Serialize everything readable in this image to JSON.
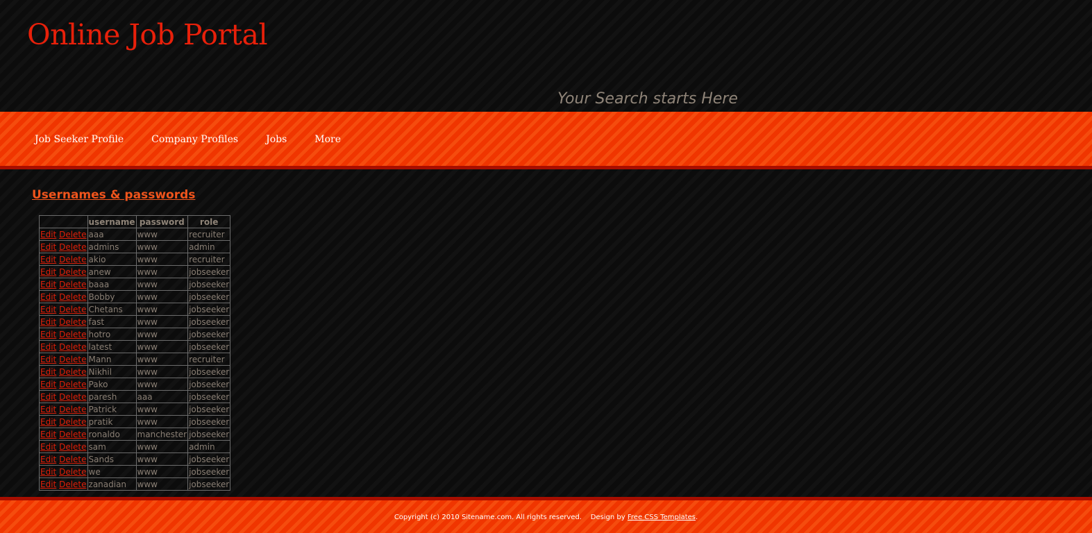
{
  "header": {
    "title": "Online Job Portal",
    "tagline": "Your Search starts Here"
  },
  "menu": {
    "items": [
      {
        "label": "Job Seeker Profile"
      },
      {
        "label": "Company Profiles"
      },
      {
        "label": "Jobs"
      },
      {
        "label": "More"
      }
    ]
  },
  "main": {
    "heading": "Usernames & passwords",
    "table": {
      "columns": [
        "",
        "username",
        "password",
        "role"
      ],
      "edit_label": "Edit",
      "delete_label": "Delete",
      "rows": [
        {
          "username": "aaa",
          "password": "www",
          "role": "recruiter"
        },
        {
          "username": "admins",
          "password": "www",
          "role": "admin"
        },
        {
          "username": "akio",
          "password": "www",
          "role": "recruiter"
        },
        {
          "username": "anew",
          "password": "www",
          "role": "jobseeker"
        },
        {
          "username": "baaa",
          "password": "www",
          "role": "jobseeker"
        },
        {
          "username": "Bobby",
          "password": "www",
          "role": "jobseeker"
        },
        {
          "username": "Chetans",
          "password": "www",
          "role": "jobseeker"
        },
        {
          "username": "fast",
          "password": "www",
          "role": "jobseeker"
        },
        {
          "username": "hotro",
          "password": "www",
          "role": "jobseeker"
        },
        {
          "username": "latest",
          "password": "www",
          "role": "jobseeker"
        },
        {
          "username": "Mann",
          "password": "www",
          "role": "recruiter"
        },
        {
          "username": "Nikhil",
          "password": "www",
          "role": "jobseeker"
        },
        {
          "username": "Pako",
          "password": "www",
          "role": "jobseeker"
        },
        {
          "username": "paresh",
          "password": "aaa",
          "role": "jobseeker"
        },
        {
          "username": "Patrick",
          "password": "www",
          "role": "jobseeker"
        },
        {
          "username": "pratik",
          "password": "www",
          "role": "jobseeker"
        },
        {
          "username": "ronaldo",
          "password": "manchester",
          "role": "jobseeker"
        },
        {
          "username": "sam",
          "password": "www",
          "role": "admin"
        },
        {
          "username": "Sands",
          "password": "www",
          "role": "jobseeker"
        },
        {
          "username": "we",
          "password": "www",
          "role": "jobseeker"
        },
        {
          "username": "zanadian",
          "password": "www",
          "role": "jobseeker"
        }
      ]
    }
  },
  "footer": {
    "copyright": "Copyright (c) 2010 Sitename.com. All rights reserved.",
    "design_prefix": "Design by",
    "design_link": "Free CSS Templates",
    "design_suffix": "."
  },
  "colors": {
    "title_red": "#e8200a",
    "menu_orange": "#f03500",
    "link_red": "#e01f08",
    "heading_orange": "#f0541c"
  }
}
